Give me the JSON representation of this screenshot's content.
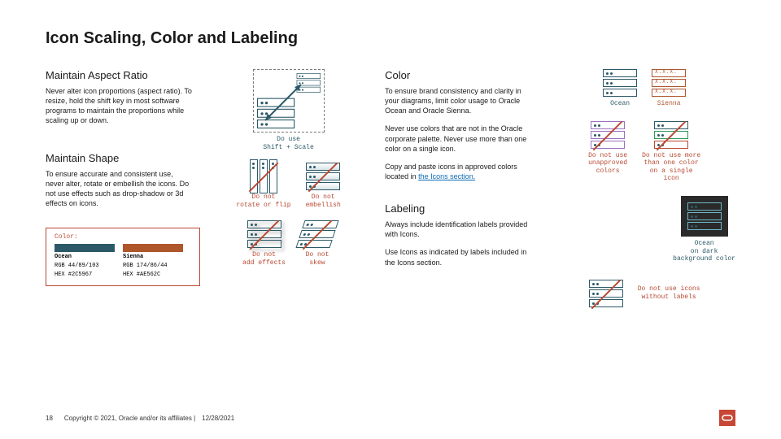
{
  "title": "Icon Scaling, Color and Labeling",
  "left": {
    "h_aspect": "Maintain Aspect Ratio",
    "p_aspect": "Never alter icon proportions (aspect ratio). To resize, hold the shift key in most software programs to maintain the proportions while scaling up or down.",
    "h_shape": "Maintain Shape",
    "p_shape": "To ensure accurate and consistent use, never alter, rotate or embellish the icons. Do not use effects such as drop-shadow or 3d effects on icons."
  },
  "mid": {
    "cap_scale": "Do use\nShift + Scale",
    "cap_rotate": "Do not\nrotate or flip",
    "cap_embellish": "Do not\nembellish",
    "cap_effects": "Do not\nadd effects",
    "cap_skew": "Do not\nskew"
  },
  "right": {
    "h_color": "Color",
    "p_color1": "To ensure brand consistency and clarity in your diagrams, limit color usage to Oracle Ocean and Oracle Sienna.",
    "p_color2": "Never use colors that are not in the Oracle corporate palette. Never use more than one color on a single icon.",
    "p_color3_a": "Copy and paste icons in approved colors located in ",
    "p_color3_link": "the Icons section.",
    "h_label": "Labeling",
    "p_label1": "Always include identification labels provided with Icons.",
    "p_label2": "Use Icons as indicated by labels included in the Icons section."
  },
  "ex": {
    "ocean": "Ocean",
    "sienna": "Sienna",
    "unapproved": "Do not use\nunapproved\ncolors",
    "multicolor": "Do not use more\nthan one color\non a single\nicon",
    "dark": "Ocean\non dark\nbackground color",
    "nolabel": "Do not use icons\nwithout labels"
  },
  "colorbox": {
    "title": "Color:",
    "ocean_name": "Ocean",
    "ocean_rgb": "RGB 44/89/103",
    "ocean_hex": "HEX #2C5967",
    "sienna_name": "Sienna",
    "sienna_rgb": "RGB 174/86/44",
    "sienna_hex": "HEX #AE562C"
  },
  "footer": {
    "page": "18",
    "copy": "Copyright © 2021, Oracle and/or its affiliates  |",
    "date": "12/28/2021"
  }
}
